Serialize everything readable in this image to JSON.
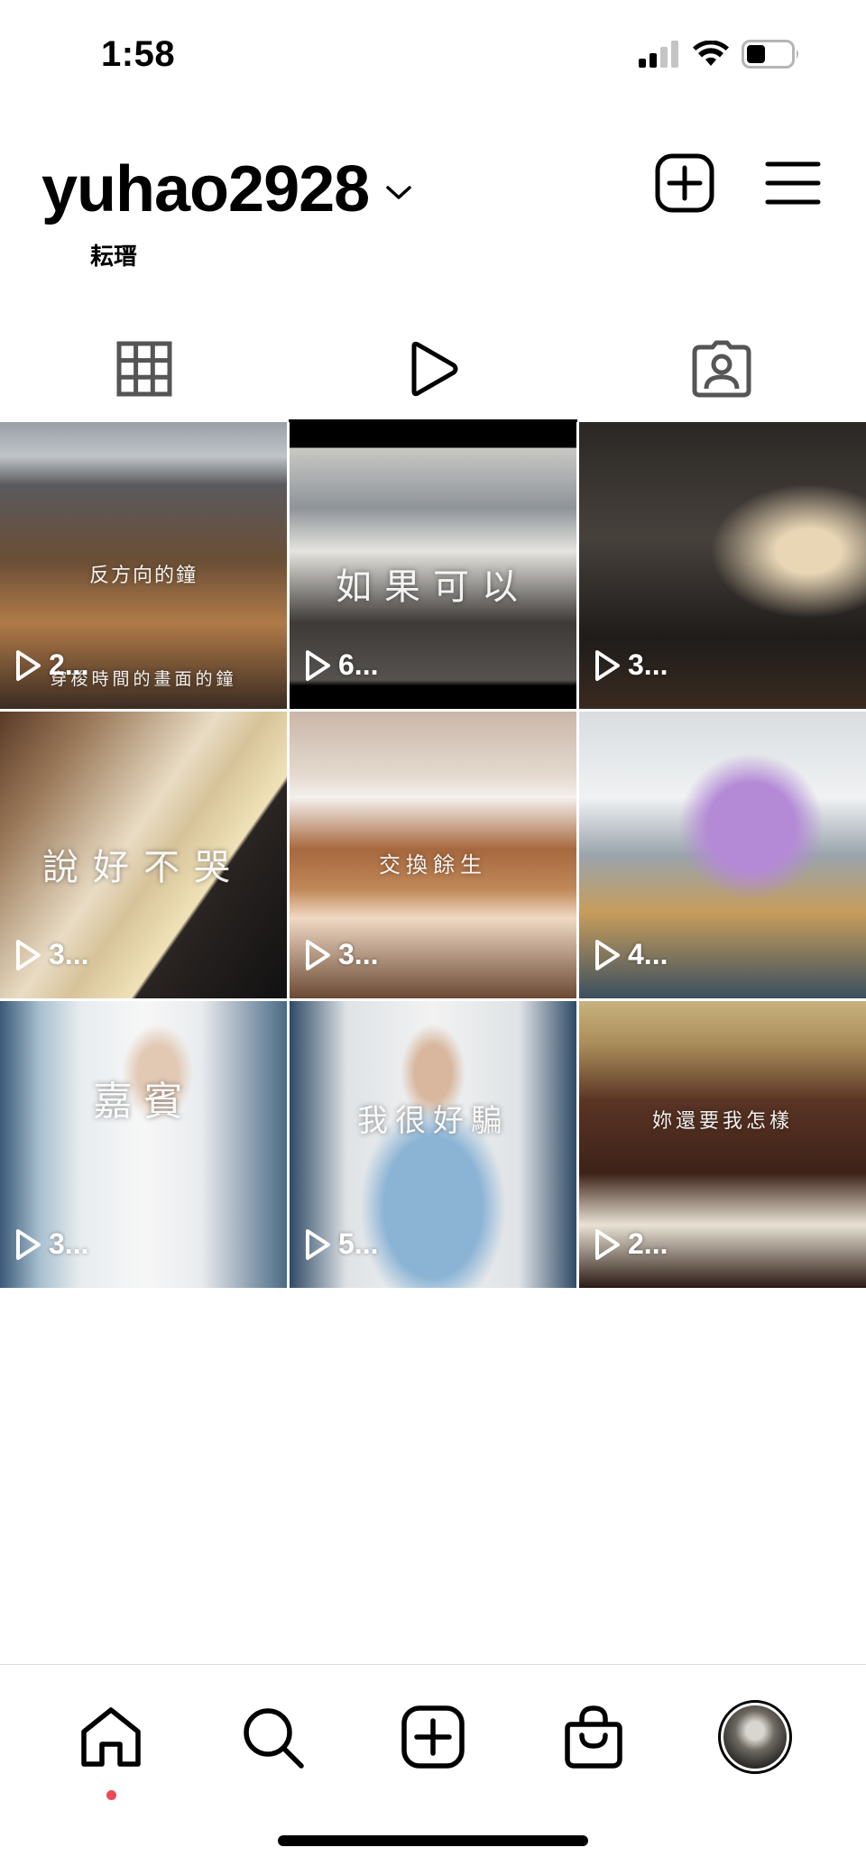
{
  "status_bar": {
    "time": "1:58"
  },
  "header": {
    "username": "yuhao2928",
    "display_name": "耘瑨"
  },
  "tabs": [
    {
      "name": "grid",
      "icon": "grid-icon",
      "active": false
    },
    {
      "name": "reels",
      "icon": "reels-play-icon",
      "active": true
    },
    {
      "name": "tagged",
      "icon": "tagged-person-icon",
      "active": false
    }
  ],
  "reels": [
    {
      "overlay_text": "反方向的鐘",
      "overlay_text_2": "穿梭時間的畫面的鐘",
      "count": "2..."
    },
    {
      "overlay_text": "如果可以",
      "count": "6..."
    },
    {
      "overlay_text": "",
      "count": "3..."
    },
    {
      "overlay_text": "說好不哭",
      "count": "3..."
    },
    {
      "overlay_text": "交換餘生",
      "count": "3..."
    },
    {
      "overlay_text": "",
      "count": "4..."
    },
    {
      "overlay_text": "嘉賓",
      "count": "3..."
    },
    {
      "overlay_text": "我很好騙",
      "count": "5..."
    },
    {
      "overlay_text": "妳還要我怎樣",
      "count": "2..."
    }
  ],
  "bottom_nav": [
    {
      "name": "home",
      "icon": "home-icon"
    },
    {
      "name": "search",
      "icon": "search-icon"
    },
    {
      "name": "create",
      "icon": "plus-square-icon"
    },
    {
      "name": "shop",
      "icon": "shopping-bag-icon"
    },
    {
      "name": "profile",
      "icon": "profile-avatar"
    }
  ],
  "colors": {
    "notification_dot": "#ed4956",
    "divider": "#dbdbdb"
  }
}
